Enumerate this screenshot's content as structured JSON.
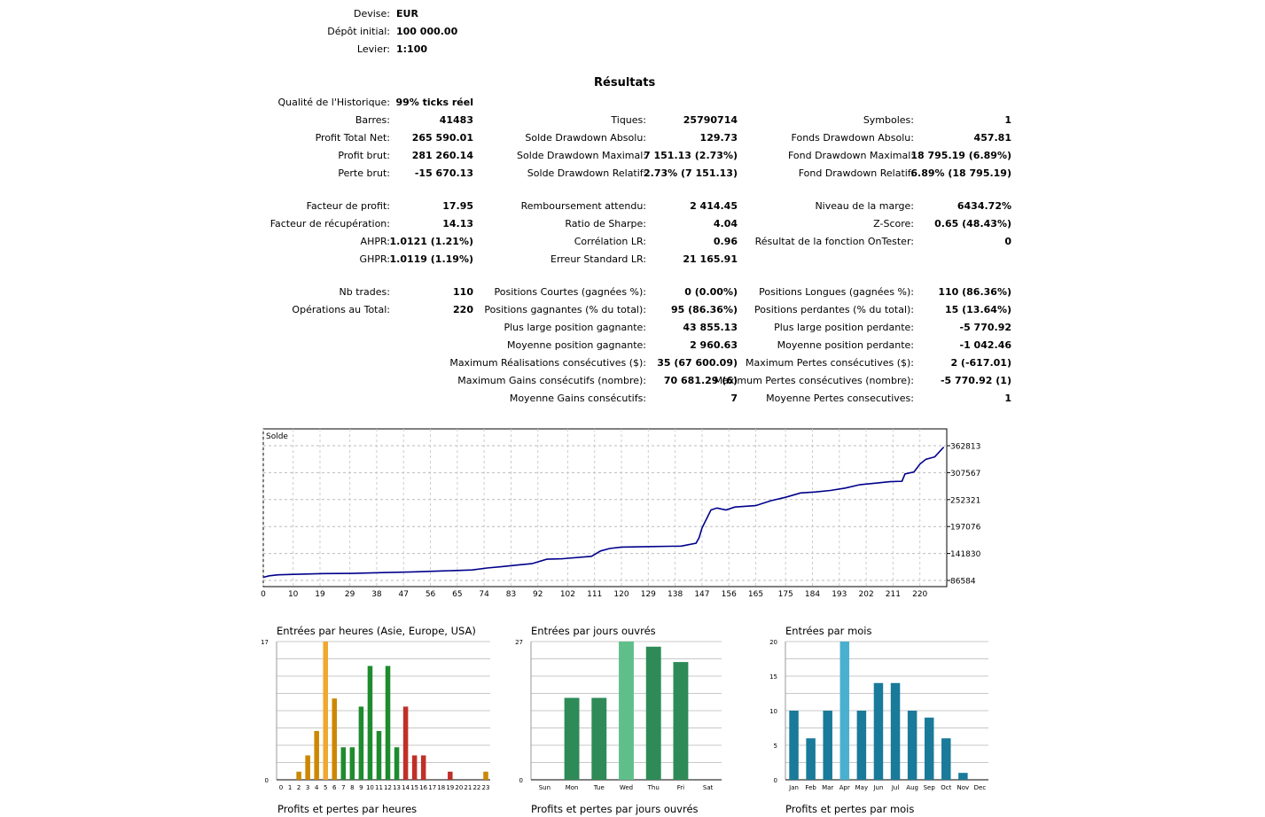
{
  "header": {
    "rows": [
      {
        "label": "Devise:",
        "value": "EUR"
      },
      {
        "label": "Dépôt initial:",
        "value": "100 000.00"
      },
      {
        "label": "Levier:",
        "value": "1:100"
      }
    ]
  },
  "results": {
    "heading": "Résultats",
    "quality": {
      "label": "Qualité de l'Historique:",
      "value": "99% ticks réel"
    },
    "rows": [
      [
        {
          "label": "Barres:",
          "value": "41483"
        },
        {
          "label": "Tiques:",
          "value": "25790714"
        },
        {
          "label": "Symboles:",
          "value": "1"
        }
      ],
      [
        {
          "label": "Profit Total Net:",
          "value": "265 590.01"
        },
        {
          "label": "Solde Drawdown Absolu:",
          "value": "129.73"
        },
        {
          "label": "Fonds Drawdown Absolu:",
          "value": "457.81"
        }
      ],
      [
        {
          "label": "Profit brut:",
          "value": "281 260.14"
        },
        {
          "label": "Solde Drawdown Maximal:",
          "value": "7 151.13 (2.73%)"
        },
        {
          "label": "Fond Drawdown Maximal:",
          "value": "18 795.19 (6.89%)"
        }
      ],
      [
        {
          "label": "Perte brut:",
          "value": "-15 670.13"
        },
        {
          "label": "Solde Drawdown Relatif:",
          "value": "2.73% (7 151.13)"
        },
        {
          "label": "Fond Drawdown Relatif:",
          "value": "6.89% (18 795.19)"
        }
      ],
      [
        {
          "label": "Facteur de profit:",
          "value": "17.95"
        },
        {
          "label": "Remboursement attendu:",
          "value": "2 414.45"
        },
        {
          "label": "Niveau de la marge:",
          "value": "6434.72%"
        }
      ],
      [
        {
          "label": "Facteur de récupération:",
          "value": "14.13"
        },
        {
          "label": "Ratio de Sharpe:",
          "value": "4.04"
        },
        {
          "label": "Z-Score:",
          "value": "0.65 (48.43%)"
        }
      ],
      [
        {
          "label": "AHPR:",
          "value": "1.0121 (1.21%)"
        },
        {
          "label": "Corrélation LR:",
          "value": "0.96"
        },
        {
          "label": "Résultat de la fonction OnTester:",
          "value": "0"
        }
      ],
      [
        {
          "label": "GHPR:",
          "value": "1.0119 (1.19%)"
        },
        {
          "label": "Erreur Standard LR:",
          "value": "21 165.91"
        },
        null
      ],
      [
        {
          "label": "Nb trades:",
          "value": "110"
        },
        {
          "label": "Positions Courtes (gagnées %):",
          "value": "0 (0.00%)"
        },
        {
          "label": "Positions Longues (gagnées %):",
          "value": "110 (86.36%)"
        }
      ],
      [
        {
          "label": "Opérations au Total:",
          "value": "220"
        },
        {
          "label": "Positions gagnantes (% du total):",
          "value": "95 (86.36%)"
        },
        {
          "label": "Positions perdantes (% du total):",
          "value": "15 (13.64%)"
        }
      ],
      [
        null,
        {
          "label": "Plus large position gagnante:",
          "value": "43 855.13"
        },
        {
          "label": "Plus large position perdante:",
          "value": "-5 770.92"
        }
      ],
      [
        null,
        {
          "label": "Moyenne position gagnante:",
          "value": "2 960.63"
        },
        {
          "label": "Moyenne position perdante:",
          "value": "-1 042.46"
        }
      ],
      [
        null,
        {
          "label": "Maximum Réalisations consécutives ($):",
          "value": "35 (67 600.09)"
        },
        {
          "label": "Maximum Pertes consécutives ($):",
          "value": "2 (-617.01)"
        }
      ],
      [
        null,
        {
          "label": "Maximum Gains consécutifs (nombre):",
          "value": "70 681.29 (6)"
        },
        {
          "label": "Maximum Pertes consécutives (nombre):",
          "value": "-5 770.92 (1)"
        }
      ],
      [
        null,
        {
          "label": "Moyenne Gains consécutifs:",
          "value": "7"
        },
        {
          "label": "Moyenne Pertes consecutives:",
          "value": "1"
        }
      ]
    ]
  },
  "bottom_titles": [
    "Profits et pertes par heures",
    "Profits et pertes par jours ouvrés",
    "Profits et pertes par mois"
  ],
  "chart_data": [
    {
      "type": "line",
      "title": "Solde",
      "ylim": [
        86584,
        362813
      ],
      "y_ticks": [
        "362813",
        "307567",
        "252321",
        "197076",
        "141830",
        "86584"
      ],
      "x_ticks": [
        "0",
        "10",
        "19",
        "29",
        "38",
        "47",
        "56",
        "65",
        "74",
        "83",
        "92",
        "102",
        "111",
        "120",
        "129",
        "138",
        "147",
        "156",
        "165",
        "175",
        "184",
        "193",
        "202",
        "211",
        "220"
      ],
      "xlim": [
        0,
        229
      ],
      "grid": true,
      "color": "#00008b",
      "x": [
        0,
        2,
        5,
        10,
        20,
        30,
        40,
        50,
        60,
        65,
        70,
        75,
        80,
        85,
        90,
        95,
        100,
        110,
        113,
        116,
        120,
        130,
        140,
        145,
        146,
        147,
        150,
        152,
        155,
        158,
        165,
        170,
        175,
        180,
        185,
        190,
        195,
        200,
        205,
        210,
        214,
        215,
        218,
        220,
        222,
        225,
        228
      ],
      "y": [
        93000,
        96000,
        98000,
        99000,
        100500,
        101000,
        102500,
        104000,
        106000,
        107000,
        108000,
        112000,
        115000,
        118000,
        121000,
        130000,
        131000,
        136000,
        147000,
        152000,
        155000,
        156000,
        157000,
        163000,
        174000,
        194000,
        231000,
        235000,
        231000,
        237000,
        240000,
        250000,
        257000,
        266000,
        268000,
        271000,
        276000,
        283000,
        286000,
        289000,
        290000,
        305000,
        309000,
        325000,
        335000,
        340000,
        360000
      ]
    },
    {
      "type": "bar",
      "title": "Entrées par heures (Asie, Europe, USA)",
      "categories": [
        "0",
        "1",
        "2",
        "3",
        "4",
        "5",
        "6",
        "7",
        "8",
        "9",
        "10",
        "11",
        "12",
        "13",
        "14",
        "15",
        "16",
        "17",
        "18",
        "19",
        "20",
        "21",
        "22",
        "23"
      ],
      "values": [
        0,
        0,
        1,
        3,
        6,
        17,
        10,
        4,
        4,
        9,
        14,
        6,
        14,
        4,
        9,
        3,
        3,
        0,
        0,
        1,
        0,
        0,
        0,
        1
      ],
      "colors": [
        "#cc8800",
        "#cc8800",
        "#cc8800",
        "#cc8800",
        "#cc8800",
        "#f0a830",
        "#cc8800",
        "#1e8c2e",
        "#1e8c2e",
        "#1e8c2e",
        "#1e8c2e",
        "#1e8c2e",
        "#1e8c2e",
        "#1e8c2e",
        "#c03028",
        "#c03028",
        "#c03028",
        "#c03028",
        "#c03028",
        "#c03028",
        "#cc8800",
        "#cc8800",
        "#cc8800",
        "#cc8800"
      ],
      "ylim": [
        0,
        17
      ],
      "y_ticks": [
        "17",
        "0"
      ]
    },
    {
      "type": "bar",
      "title": "Entrées par jours ouvrés",
      "categories": [
        "Sun",
        "Mon",
        "Tue",
        "Wed",
        "Thu",
        "Fri",
        "Sat"
      ],
      "values": [
        0,
        16,
        16,
        27,
        26,
        23,
        0
      ],
      "colors": [
        "#2e8b57",
        "#2e8b57",
        "#2e8b57",
        "#5fbf8a",
        "#2e8b57",
        "#2e8b57",
        "#2e8b57"
      ],
      "ylim": [
        0,
        27
      ],
      "y_ticks": [
        "27",
        "0"
      ]
    },
    {
      "type": "bar",
      "title": "Entrées par mois",
      "categories": [
        "Jan",
        "Feb",
        "Mar",
        "Apr",
        "May",
        "Jun",
        "Jul",
        "Aug",
        "Sep",
        "Oct",
        "Nov",
        "Dec"
      ],
      "values": [
        10,
        6,
        10,
        20,
        10,
        14,
        14,
        10,
        9,
        6,
        1,
        0
      ],
      "colors": [
        "#1a7a9a",
        "#1a7a9a",
        "#1a7a9a",
        "#4ab0d0",
        "#1a7a9a",
        "#1a7a9a",
        "#1a7a9a",
        "#1a7a9a",
        "#1a7a9a",
        "#1a7a9a",
        "#1a7a9a",
        "#1a7a9a"
      ],
      "ylim": [
        0,
        20
      ],
      "y_ticks": [
        "20",
        "15",
        "10",
        "5",
        "0"
      ]
    }
  ]
}
